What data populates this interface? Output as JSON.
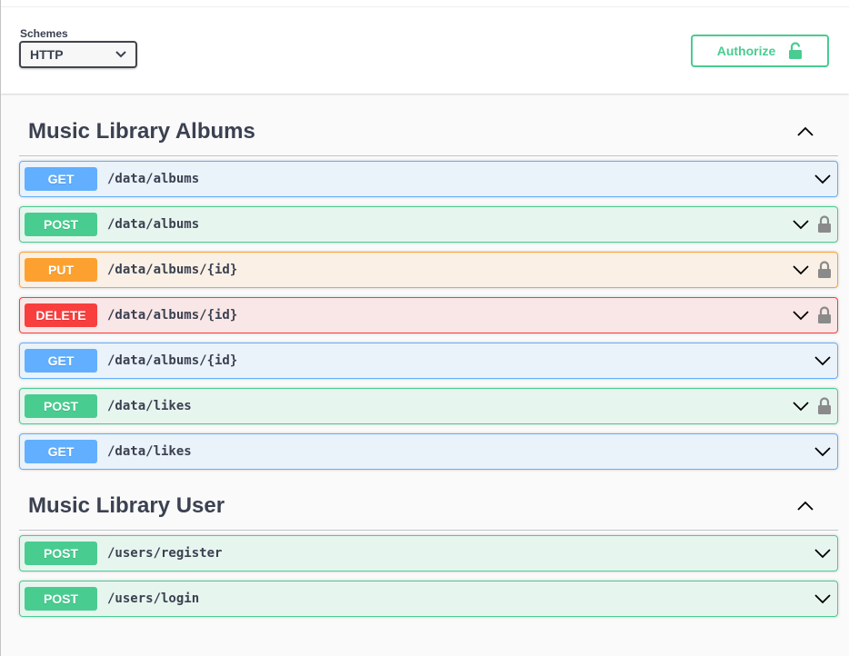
{
  "scheme_bar": {
    "schemes_label": "Schemes",
    "selected_scheme": "HTTP",
    "authorize_label": "Authorize"
  },
  "colors": {
    "get": "#61affe",
    "post": "#49cc90",
    "put": "#fca130",
    "delete": "#f93e3e",
    "lock": "#8a8a8a"
  },
  "sections": [
    {
      "title": "Music Library Albums",
      "operations": [
        {
          "method": "GET",
          "path": "/data/albums"
        },
        {
          "method": "POST",
          "path": "/data/albums"
        },
        {
          "method": "PUT",
          "path": "/data/albums/{id}"
        },
        {
          "method": "DELETE",
          "path": "/data/albums/{id}"
        },
        {
          "method": "GET",
          "path": "/data/albums/{id}"
        },
        {
          "method": "POST",
          "path": "/data/likes"
        },
        {
          "method": "GET",
          "path": "/data/likes"
        }
      ]
    },
    {
      "title": "Music Library User",
      "operations": [
        {
          "method": "POST",
          "path": "/users/register"
        },
        {
          "method": "POST",
          "path": "/users/login"
        }
      ]
    }
  ]
}
